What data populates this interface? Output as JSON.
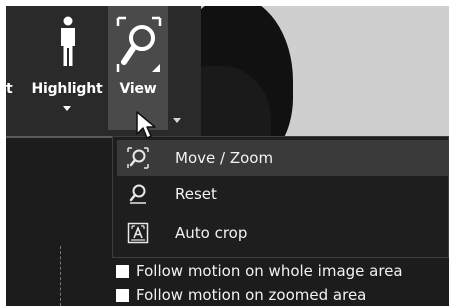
{
  "toolbar": {
    "edge_label": "t",
    "highlight_label": "Highlight",
    "view_label": "View"
  },
  "view_menu": {
    "items": [
      {
        "label": "Move / Zoom",
        "icon": "magnifier-move-icon",
        "active": true
      },
      {
        "label": "Reset",
        "icon": "magnifier-reset-icon",
        "active": false
      },
      {
        "label": "Auto crop",
        "icon": "auto-crop-icon",
        "active": false
      }
    ]
  },
  "options": [
    {
      "label": "Follow motion on whole image area",
      "checked": false
    },
    {
      "label": "Follow motion on zoomed area",
      "checked": false
    }
  ],
  "colors": {
    "panel_bg": "#1c1c1c",
    "toolbar_bg": "#2a2a2a",
    "view_button_active": "#4a4a4a",
    "menu_highlight": "#3a3a3a",
    "text": "#f2f2f2"
  }
}
